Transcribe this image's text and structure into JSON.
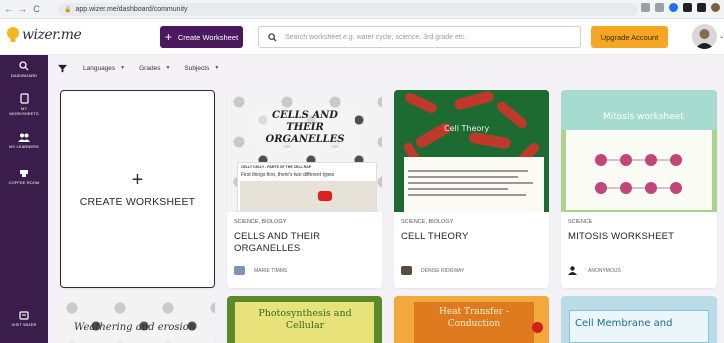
{
  "browser": {
    "url": "app.wizer.me/dashboard/community",
    "back": "←",
    "forward": "→",
    "reload": "C"
  },
  "header": {
    "logo_text": "wizer.me",
    "create_label": "Create Worksheet",
    "search_placeholder": "Search worksheet e.g. water cycle, science, 3rd grade etc.",
    "upgrade_label": "Upgrade Account"
  },
  "sidebar": {
    "items": [
      {
        "label": "Dashboard",
        "icon": "search-icon"
      },
      {
        "label": "My Worksheets",
        "icon": "worksheet-icon"
      },
      {
        "label": "My Learners",
        "icon": "learners-icon"
      },
      {
        "label": "Coffee Room",
        "icon": "coffee-icon"
      },
      {
        "label": "Visit Wizer",
        "icon": "visit-icon"
      }
    ]
  },
  "filters": {
    "items": [
      "Languages",
      "Grades",
      "Subjects"
    ]
  },
  "create_card": {
    "plus": "+",
    "label": "CREATE WORKSHEET"
  },
  "cards": [
    {
      "category": "SCIENCE, BIOLOGY",
      "title": "CELLS AND THEIR ORGANELLES",
      "author": "MARIE TIMMS",
      "thumb_title": "CELLS AND THEIR ORGANELLES",
      "thumb_small": "CELLY CELLY - PARTS OF THE CELL RAP",
      "thumb_text": "First things first, there's two different types"
    },
    {
      "category": "SCIENCE, BIOLOGY",
      "title": "CELL THEORY",
      "author": "DENISE RIDGWAY",
      "thumb_title": "Cell Theory"
    },
    {
      "category": "SCIENCE",
      "title": "MITOSIS WORKSHEET",
      "author": "ANONYMOUS",
      "thumb_title": "Mitosis worksheet"
    }
  ],
  "bottom_cards": [
    {
      "thumb_title": "Weathering and erosion"
    },
    {
      "thumb_title": "Photosynthesis and Cellular"
    },
    {
      "thumb_title": "Heat Transfer - Conduction"
    },
    {
      "thumb_title": "Cell Membrane and"
    }
  ],
  "colors": {
    "brand_purple": "#4b1a5e",
    "sidebar": "#3a1d4b",
    "upgrade": "#f5a623"
  }
}
